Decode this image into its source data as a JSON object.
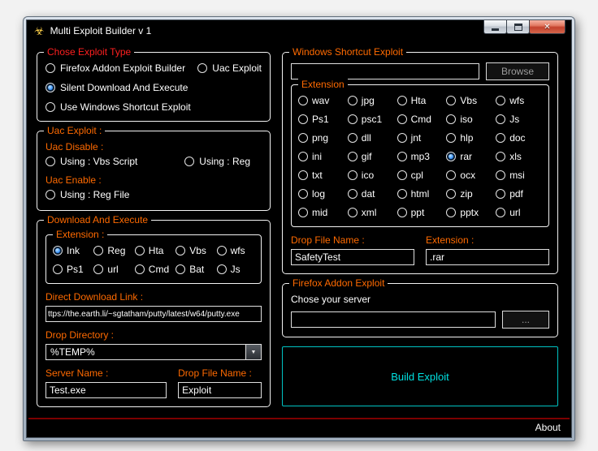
{
  "window": {
    "title": "Multi Exploit Builder v 1",
    "about_label": "About"
  },
  "icons": {
    "biohazard": "☣",
    "close": "✕",
    "dropdown_arrow": "▼"
  },
  "colors": {
    "label_orange": "#ff6a00",
    "title_red": "#ff1f1f",
    "build_cyan": "#00e0e0",
    "separator_red": "#7c0000",
    "radio_selected_blue": "#2a8cff"
  },
  "chose_type": {
    "title": "Chose Exploit Type",
    "options": [
      {
        "label": "Firefox Addon Exploit Builder",
        "checked": false
      },
      {
        "label": "Uac Exploit",
        "checked": false
      },
      {
        "label": "Silent Download And Execute",
        "checked": true
      },
      {
        "label": "Use Windows Shortcut Exploit",
        "checked": false
      }
    ]
  },
  "uac": {
    "title": "Uac Exploit :",
    "disable_label": "Uac Disable :",
    "disable_options": [
      {
        "label": "Using : Vbs Script",
        "checked": false
      },
      {
        "label": "Using : Reg",
        "checked": false
      }
    ],
    "enable_label": "Uac Enable :",
    "enable_options": [
      {
        "label": "Using : Reg File",
        "checked": false
      }
    ]
  },
  "download_execute": {
    "title": "Download And Execute",
    "extension_title": "Extension :",
    "extensions": [
      {
        "label": "Ink",
        "checked": true
      },
      {
        "label": "Reg",
        "checked": false
      },
      {
        "label": "Hta",
        "checked": false
      },
      {
        "label": "Vbs",
        "checked": false
      },
      {
        "label": "wfs",
        "checked": false
      },
      {
        "label": "Ps1",
        "checked": false
      },
      {
        "label": "url",
        "checked": false
      },
      {
        "label": "Cmd",
        "checked": false
      },
      {
        "label": "Bat",
        "checked": false
      },
      {
        "label": "Js",
        "checked": false
      }
    ],
    "direct_link_label": "Direct Download Link :",
    "direct_link_value": "ttps://the.earth.li/~sgtatham/putty/latest/w64/putty.exe",
    "drop_directory_label": "Drop Directory :",
    "drop_directory_value": "%TEMP%",
    "server_name_label": "Server Name :",
    "server_name_value": "Test.exe",
    "drop_file_label": "Drop File Name :",
    "drop_file_value": "Exploit"
  },
  "shortcut": {
    "title": "Windows Shortcut Exploit",
    "file_value": "",
    "browse_label": "Browse",
    "extension_group_title": "Extension",
    "extensions": [
      {
        "label": "wav",
        "checked": false
      },
      {
        "label": "jpg",
        "checked": false
      },
      {
        "label": "Hta",
        "checked": false
      },
      {
        "label": "Vbs",
        "checked": false
      },
      {
        "label": "wfs",
        "checked": false
      },
      {
        "label": "Ps1",
        "checked": false
      },
      {
        "label": "psc1",
        "checked": false
      },
      {
        "label": "Cmd",
        "checked": false
      },
      {
        "label": "iso",
        "checked": false
      },
      {
        "label": "Js",
        "checked": false
      },
      {
        "label": "png",
        "checked": false
      },
      {
        "label": "dll",
        "checked": false
      },
      {
        "label": "jnt",
        "checked": false
      },
      {
        "label": "hlp",
        "checked": false
      },
      {
        "label": "doc",
        "checked": false
      },
      {
        "label": "ini",
        "checked": false
      },
      {
        "label": "gif",
        "checked": false
      },
      {
        "label": "mp3",
        "checked": false
      },
      {
        "label": "rar",
        "checked": true
      },
      {
        "label": "xls",
        "checked": false
      },
      {
        "label": "txt",
        "checked": false
      },
      {
        "label": "ico",
        "checked": false
      },
      {
        "label": "cpl",
        "checked": false
      },
      {
        "label": "ocx",
        "checked": false
      },
      {
        "label": "msi",
        "checked": false
      },
      {
        "label": "log",
        "checked": false
      },
      {
        "label": "dat",
        "checked": false
      },
      {
        "label": "html",
        "checked": false
      },
      {
        "label": "zip",
        "checked": false
      },
      {
        "label": "pdf",
        "checked": false
      },
      {
        "label": "mid",
        "checked": false
      },
      {
        "label": "xml",
        "checked": false
      },
      {
        "label": "ppt",
        "checked": false
      },
      {
        "label": "pptx",
        "checked": false
      },
      {
        "label": "url",
        "checked": false
      }
    ],
    "drop_file_label": "Drop File Name :",
    "drop_file_value": "SafetyTest",
    "extension_label": "Extension :",
    "extension_value": ".rar"
  },
  "firefox": {
    "title": "Firefox Addon Exploit",
    "server_label": "Chose your server",
    "server_value": "",
    "more_label": "..."
  },
  "build": {
    "label": "Build Exploit"
  }
}
